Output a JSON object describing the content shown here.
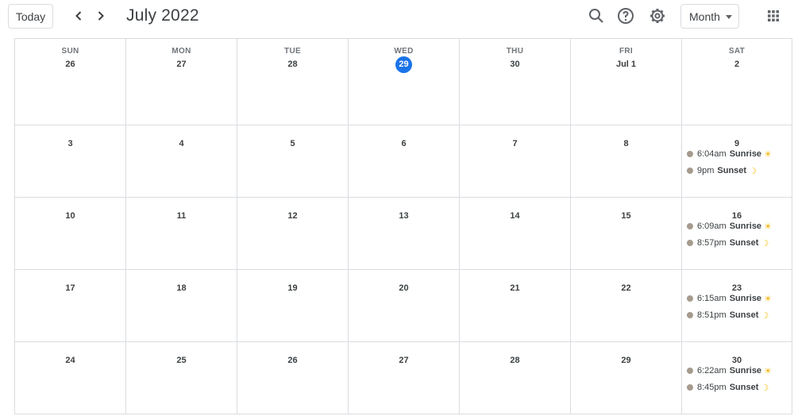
{
  "header": {
    "today_label": "Today",
    "title": "July 2022",
    "view_label": "Month",
    "icons": [
      "chevron-left-icon",
      "chevron-right-icon",
      "search-icon",
      "help-icon",
      "settings-icon",
      "apps-icon"
    ]
  },
  "days_of_week": [
    "SUN",
    "MON",
    "TUE",
    "WED",
    "THU",
    "FRI",
    "SAT"
  ],
  "weeks": [
    [
      "26",
      "27",
      "28",
      "29",
      "30",
      "Jul 1",
      "2"
    ],
    [
      "3",
      "4",
      "5",
      "6",
      "7",
      "8",
      "9"
    ],
    [
      "10",
      "11",
      "12",
      "13",
      "14",
      "15",
      "16"
    ],
    [
      "17",
      "18",
      "19",
      "20",
      "21",
      "22",
      "23"
    ],
    [
      "24",
      "25",
      "26",
      "27",
      "28",
      "29",
      "30"
    ]
  ],
  "today": "29",
  "event_color": "#a79b8e",
  "accent": "#1a73e8",
  "events": [
    {
      "week": 1,
      "day": 6,
      "sunrise": "6:04am",
      "sunset": "9pm"
    },
    {
      "week": 2,
      "day": 6,
      "sunrise": "6:09am",
      "sunset": "8:57pm"
    },
    {
      "week": 3,
      "day": 6,
      "sunrise": "6:15am",
      "sunset": "8:51pm"
    },
    {
      "week": 4,
      "day": 6,
      "sunrise": "6:22am",
      "sunset": "8:45pm"
    }
  ],
  "event_labels": {
    "sunrise": "Sunrise",
    "sunset": "Sunset",
    "sunrise_emoji": "☀",
    "sunset_emoji": "☽"
  }
}
